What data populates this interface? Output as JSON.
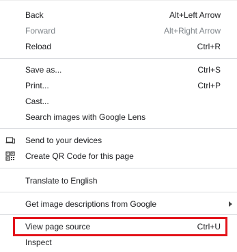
{
  "menu": {
    "back": {
      "label": "Back",
      "shortcut": "Alt+Left Arrow"
    },
    "forward": {
      "label": "Forward",
      "shortcut": "Alt+Right Arrow"
    },
    "reload": {
      "label": "Reload",
      "shortcut": "Ctrl+R"
    },
    "save_as": {
      "label": "Save as...",
      "shortcut": "Ctrl+S"
    },
    "print": {
      "label": "Print...",
      "shortcut": "Ctrl+P"
    },
    "cast": {
      "label": "Cast..."
    },
    "lens": {
      "label": "Search images with Google Lens"
    },
    "send_devices": {
      "label": "Send to your devices",
      "icon": "device-icon"
    },
    "qr_code": {
      "label": "Create QR Code for this page",
      "icon": "qr-code-icon"
    },
    "translate": {
      "label": "Translate to English"
    },
    "image_desc": {
      "label": "Get image descriptions from Google"
    },
    "view_source": {
      "label": "View page source",
      "shortcut": "Ctrl+U"
    },
    "inspect": {
      "label": "Inspect"
    }
  },
  "highlight_color": "#e3141b"
}
